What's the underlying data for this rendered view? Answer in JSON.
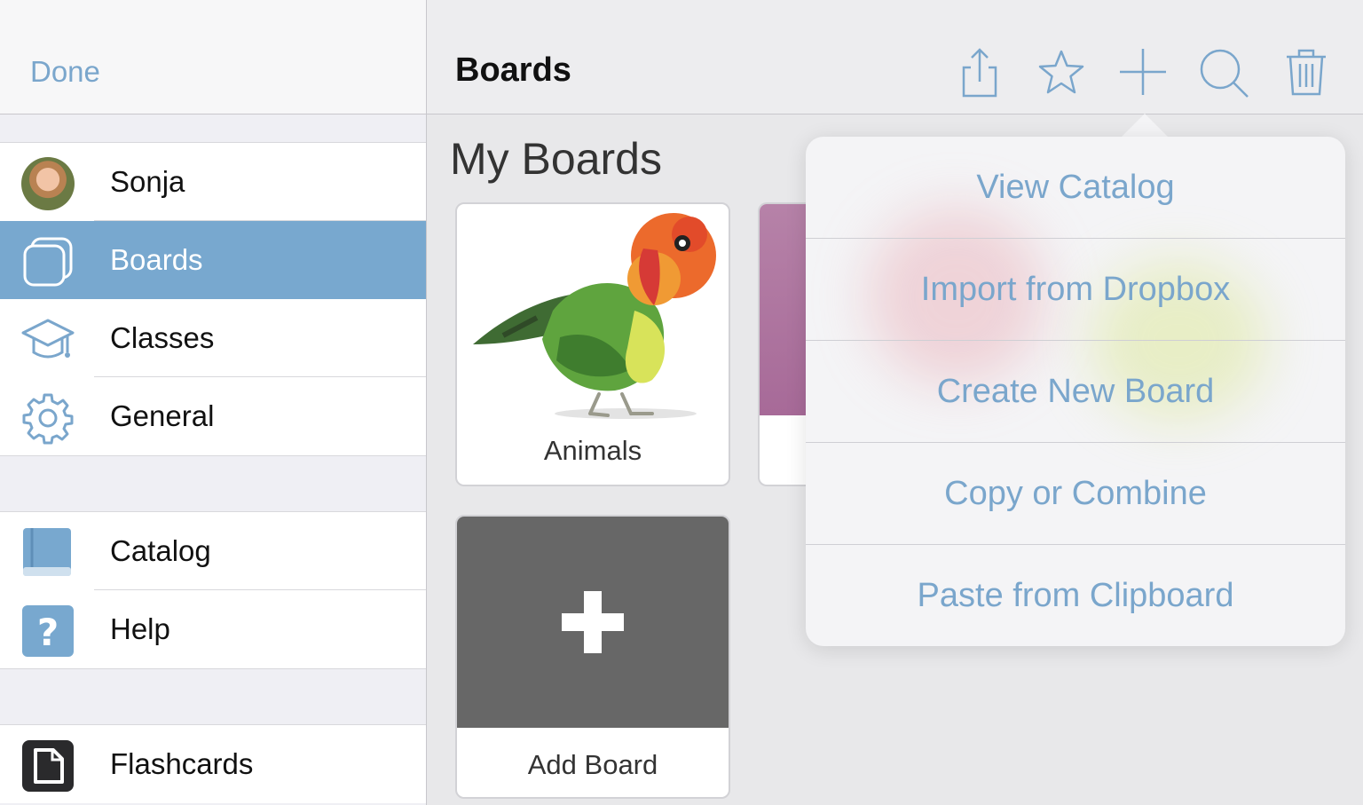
{
  "sidebar": {
    "done_label": "Done",
    "profile": {
      "name": "Sonja"
    },
    "items": [
      {
        "label": "Boards",
        "icon": "boards-icon"
      },
      {
        "label": "Classes",
        "icon": "graduation-cap-icon"
      },
      {
        "label": "General",
        "icon": "gear-icon"
      }
    ],
    "resources": [
      {
        "label": "Catalog",
        "icon": "book-icon"
      },
      {
        "label": "Help",
        "icon": "help-icon"
      }
    ],
    "extras": [
      {
        "label": "Flashcards",
        "icon": "flashcard-icon"
      }
    ]
  },
  "nav": {
    "title": "Boards",
    "actions": [
      "share-icon",
      "star-icon",
      "plus-icon",
      "search-icon",
      "trash-icon"
    ]
  },
  "main": {
    "section_title": "My Boards",
    "boards": [
      {
        "label": "Animals"
      }
    ],
    "add_board_label": "Add Board"
  },
  "popover": {
    "items": [
      "View Catalog",
      "Import from Dropbox",
      "Create New Board",
      "Copy or Combine",
      "Paste from Clipboard"
    ]
  },
  "colors": {
    "accent": "#7aa6cc",
    "selected": "#78a8cf",
    "add_tile": "#676767"
  }
}
